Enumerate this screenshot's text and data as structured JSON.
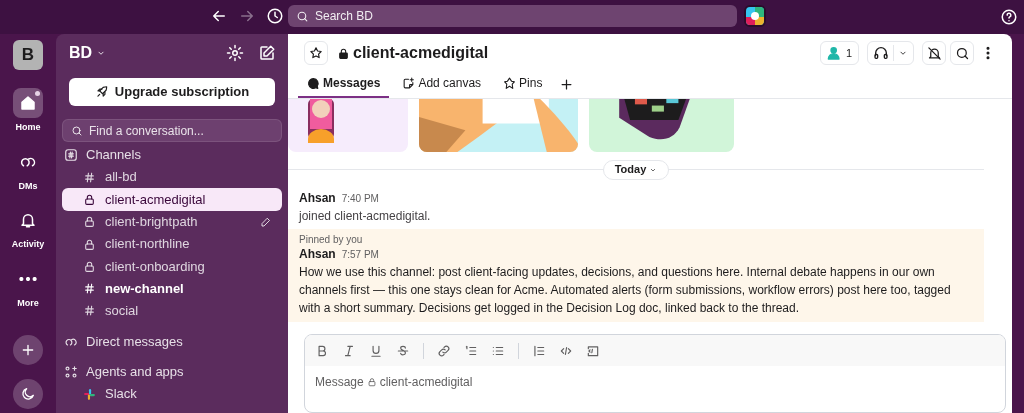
{
  "top_bar": {
    "search_placeholder": "Search BD"
  },
  "rail": {
    "workspace_initial": "B",
    "items": [
      {
        "label": "Home",
        "selected": true,
        "kind": "home",
        "badge": true
      },
      {
        "label": "DMs",
        "selected": false,
        "kind": "dms",
        "badge": false
      },
      {
        "label": "Activity",
        "selected": false,
        "kind": "activity",
        "badge": false
      },
      {
        "label": "More",
        "selected": false,
        "kind": "more",
        "badge": false
      }
    ]
  },
  "sidebar": {
    "workspace": "BD",
    "upgrade_button": "Upgrade subscription",
    "find_placeholder": "Find a conversation...",
    "channels_header": "Channels",
    "channels": [
      {
        "name": "all-bd",
        "kind": "public",
        "selected": false,
        "unread": false,
        "draft": false
      },
      {
        "name": "client-acmedigital",
        "kind": "private",
        "selected": true,
        "unread": false,
        "draft": false
      },
      {
        "name": "client-brightpath",
        "kind": "private",
        "selected": false,
        "unread": false,
        "draft": true
      },
      {
        "name": "client-northline",
        "kind": "private",
        "selected": false,
        "unread": false,
        "draft": false
      },
      {
        "name": "client-onboarding",
        "kind": "private",
        "selected": false,
        "unread": false,
        "draft": false
      },
      {
        "name": "new-channel",
        "kind": "public",
        "selected": false,
        "unread": true,
        "draft": false
      },
      {
        "name": "social",
        "kind": "public",
        "selected": false,
        "unread": false,
        "draft": false
      }
    ],
    "direct_messages_header": "Direct messages",
    "apps_header": "Agents and apps",
    "apps": [
      {
        "name": "Slack"
      }
    ]
  },
  "channel": {
    "name": "client-acmedigital",
    "member_count": "1",
    "tabs": [
      {
        "label": "Messages",
        "kind": "messages",
        "selected": true
      },
      {
        "label": "Add canvas",
        "kind": "canvas",
        "selected": false
      },
      {
        "label": "Pins",
        "kind": "pins",
        "selected": false
      }
    ],
    "date_divider": "Today",
    "messages": [
      {
        "author": "Ahsan",
        "time": "7:40 PM",
        "text": "joined client-acmedigital.",
        "kind": "system"
      },
      {
        "author": "Ahsan",
        "time": "7:57 PM",
        "text": "How we use this channel: post client-facing updates, decisions, and questions here. Internal debate happens in our own channels first — this one stays clean for Acme. Automated alerts (form submissions, workflow errors) post here too, tagged with a short summary. Decisions get logged in the Decision Log doc, linked back to the thread.",
        "kind": "pinned",
        "pinned_label": "Pinned by you"
      }
    ],
    "composer_placeholder": "Message",
    "composer_channel": "client-acmedigital"
  }
}
